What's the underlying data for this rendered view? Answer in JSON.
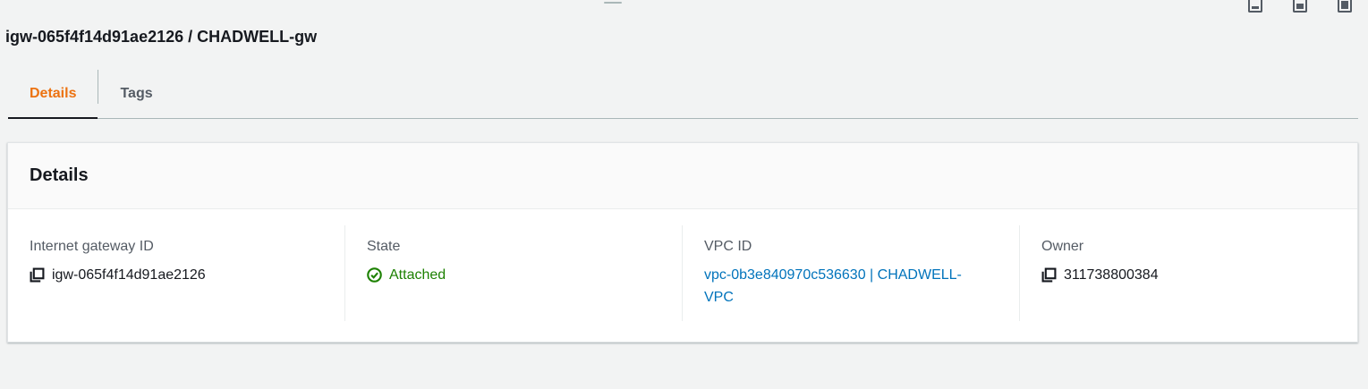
{
  "page": {
    "title": "igw-065f4f14d91ae2126 / CHADWELL-gw"
  },
  "tabs": [
    {
      "label": "Details",
      "active": true
    },
    {
      "label": "Tags",
      "active": false
    }
  ],
  "panel": {
    "heading": "Details",
    "fields": [
      {
        "label": "Internet gateway ID",
        "value": "igw-065f4f14d91ae2126",
        "icon": "copy-icon"
      },
      {
        "label": "State",
        "value": "Attached",
        "icon": "check-circle-icon",
        "status_color": "#1d8102"
      },
      {
        "label": "VPC ID",
        "value": "vpc-0b3e840970c536630 | CHADWELL-VPC",
        "link_color": "#0073bb"
      },
      {
        "label": "Owner",
        "value": "311738800384",
        "icon": "copy-icon"
      }
    ]
  },
  "colors": {
    "accent": "#ec7211",
    "link": "#0073bb",
    "success": "#1d8102"
  }
}
